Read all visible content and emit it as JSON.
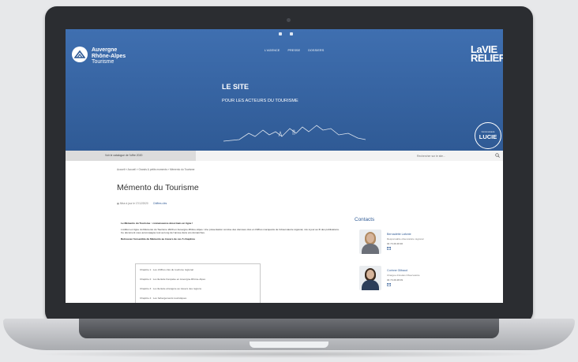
{
  "header": {
    "brand_line1": "Auvergne",
    "brand_line2": "Rhône-Alpes",
    "brand_line3": "Tourisme",
    "nav": [
      "L'AGENCE",
      "PRESSE",
      "DOSSIERS"
    ],
    "lavie_line1": "LaVIE",
    "lavie_line2": "RELIEF",
    "site_title": "LE SITE",
    "site_subtitle": "POUR LES ACTEURS DU TOURISME",
    "lucie_line1": "Communauté",
    "lucie_line2": "LUCIE"
  },
  "bar": {
    "left_label": "Voir le catalogue de l'offre 2020",
    "search_placeholder": "Rechercher sur le site..."
  },
  "breadcrumb": "Accueil » Accueil » Grands & petits moments » Mémento du Tourisme",
  "page": {
    "title": "Mémento du Tourisme",
    "date": "Mise à jour le 17/12/2020",
    "category": "Chiffres clés"
  },
  "content": {
    "heading": "Le Mémento du Tourisme : connaissance désormais en ligne !",
    "para1": "L'édition en ligne du Mémento du Tourisme 2020 en Auvergne-Rhône-Alpes. Une présentation concise des données clés et chiffres marquants de l'observatoire régional, mis à jour au fil des publications. Ce document vous accompagne tout au long de l'année dans vos démarches.",
    "subheading": "Retrouvez l'ensemble du Mémento au travers de ces 5 chapitres",
    "chapters": [
      "Chapitre 1 : Les chiffres clés du tourisme régional",
      "Chapitre 2 : La clientèle française en Auvergne-Rhône-Alpes",
      "Chapitre 3 : La clientèle étrangère au travers des régions",
      "Chapitre 4 : Les hébergements touristiques"
    ]
  },
  "contacts": {
    "title": "Contacts",
    "items": [
      {
        "name": "Bernadette Lafonte",
        "role": "Responsable observatoire régional",
        "phone": "04 73 29 49 96"
      },
      {
        "name": "Corinne Gilbaud",
        "role": "Chargée d'études Observatoire",
        "phone": "04 73 29 48 09"
      }
    ]
  },
  "colors": {
    "hero_blue": "#2f5a95",
    "accent": "#2f5a95"
  }
}
